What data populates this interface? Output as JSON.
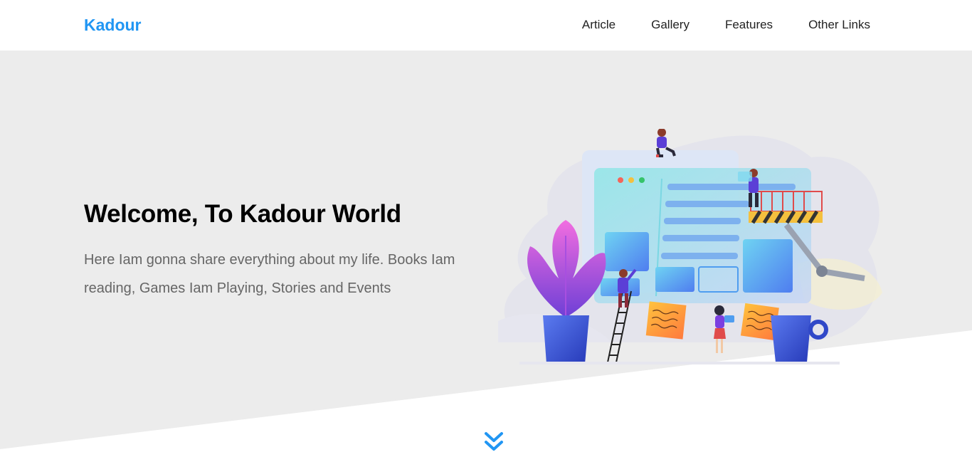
{
  "header": {
    "logo": "Kadour",
    "nav": [
      {
        "label": "Article"
      },
      {
        "label": "Gallery"
      },
      {
        "label": "Features"
      },
      {
        "label": "Other Links"
      }
    ]
  },
  "hero": {
    "title": "Welcome, To Kadour World",
    "description": "Here Iam gonna share everything about my life. Books Iam reading, Games Iam Playing, Stories and Events"
  },
  "icons": {
    "scroll": "double-chevron-down-icon"
  },
  "colors": {
    "accent": "#2196f3",
    "hero_bg": "#ececec",
    "title": "#000000",
    "body_text": "#666666"
  }
}
